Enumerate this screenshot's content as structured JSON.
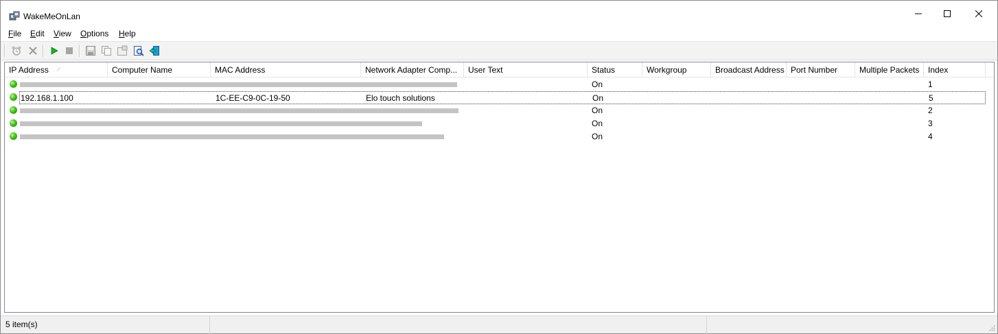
{
  "window": {
    "title": "WakeMeOnLan"
  },
  "menu": [
    {
      "key": "F",
      "rest": "ile"
    },
    {
      "key": "E",
      "rest": "dit"
    },
    {
      "key": "V",
      "rest": "iew"
    },
    {
      "key": "O",
      "rest": "ptions"
    },
    {
      "key": "H",
      "rest": "elp"
    }
  ],
  "toolbar": {
    "icons": [
      "alarm-icon",
      "delete-icon",
      "play-icon",
      "stop-icon",
      "save-icon",
      "copy-icon",
      "properties-icon",
      "find-icon",
      "exit-icon"
    ]
  },
  "columns": [
    "IP Address",
    "Computer Name",
    "MAC Address",
    "Network Adapter Comp...",
    "User Text",
    "Status",
    "Workgroup",
    "Broadcast Address",
    "Port Number",
    "Multiple Packets",
    "Index"
  ],
  "sort_indicator": "⁄",
  "rows": [
    {
      "ip": "",
      "computer": "",
      "mac": "",
      "adapter": "",
      "user_text": "",
      "status": "On",
      "workgroup": "",
      "broadcast": "",
      "port": "",
      "multiple": "",
      "index": "1",
      "redacted": true
    },
    {
      "ip": "192.168.1.100",
      "computer": "",
      "mac": "1C-EE-C9-0C-19-50",
      "adapter": "Elo touch solutions",
      "user_text": "",
      "status": "On",
      "workgroup": "",
      "broadcast": "",
      "port": "",
      "multiple": "",
      "index": "5",
      "redacted": false,
      "selected": true
    },
    {
      "ip": "",
      "computer": "",
      "mac": "",
      "adapter": "",
      "user_text": "",
      "status": "On",
      "workgroup": "",
      "broadcast": "",
      "port": "",
      "multiple": "",
      "index": "2",
      "redacted": true
    },
    {
      "ip": "",
      "computer": "",
      "mac": "",
      "adapter": "",
      "user_text": "",
      "status": "On",
      "workgroup": "",
      "broadcast": "",
      "port": "",
      "multiple": "",
      "index": "3",
      "redacted": true
    },
    {
      "ip": "",
      "computer": "",
      "mac": "",
      "adapter": "",
      "user_text": "",
      "status": "On",
      "workgroup": "",
      "broadcast": "",
      "port": "",
      "multiple": "",
      "index": "4",
      "redacted": true
    }
  ],
  "statusbar": {
    "count": "5 item(s)"
  },
  "colors": {
    "status_on": "#43c21a",
    "redaction": "#c4c4c4"
  }
}
